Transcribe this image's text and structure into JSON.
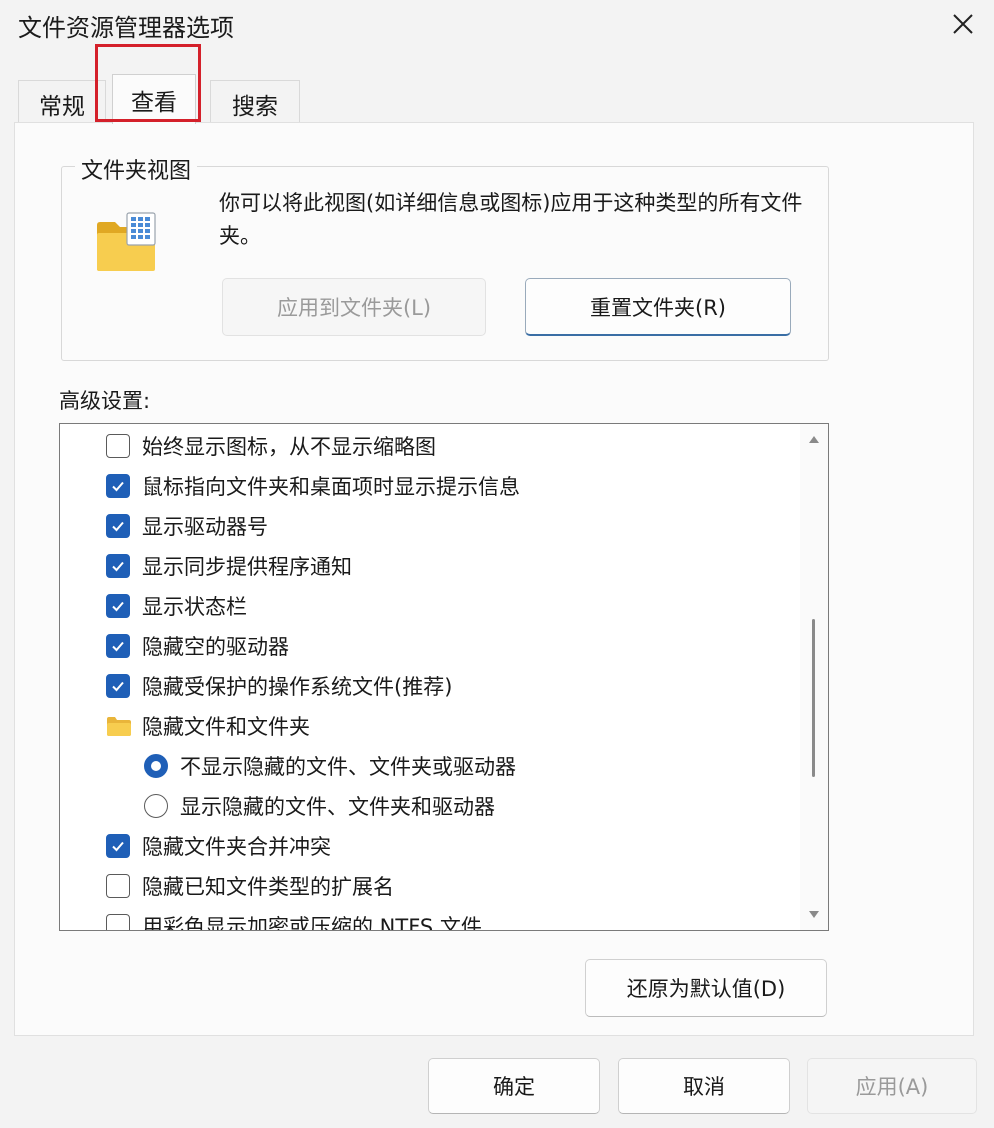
{
  "window": {
    "title": "文件资源管理器选项"
  },
  "tabs": [
    {
      "label": "常规"
    },
    {
      "label": "查看",
      "selected": true
    },
    {
      "label": "搜索"
    }
  ],
  "folder_views": {
    "title": "文件夹视图",
    "description": "你可以将此视图(如详细信息或图标)应用于这种类型的所有文件夹。",
    "apply_button": "应用到文件夹(L)",
    "reset_button": "重置文件夹(R)"
  },
  "advanced": {
    "label": "高级设置:",
    "items": [
      {
        "kind": "checkbox",
        "label": "始终显示图标，从不显示缩略图",
        "checked": false
      },
      {
        "kind": "checkbox",
        "label": "鼠标指向文件夹和桌面项时显示提示信息",
        "checked": true
      },
      {
        "kind": "checkbox",
        "label": "显示驱动器号",
        "checked": true
      },
      {
        "kind": "checkbox",
        "label": "显示同步提供程序通知",
        "checked": true
      },
      {
        "kind": "checkbox",
        "label": "显示状态栏",
        "checked": true
      },
      {
        "kind": "checkbox",
        "label": "隐藏空的驱动器",
        "checked": true
      },
      {
        "kind": "checkbox",
        "label": "隐藏受保护的操作系统文件(推荐)",
        "checked": true
      },
      {
        "kind": "folder",
        "label": "隐藏文件和文件夹"
      },
      {
        "kind": "radio",
        "label": "不显示隐藏的文件、文件夹或驱动器",
        "checked": true
      },
      {
        "kind": "radio",
        "label": "显示隐藏的文件、文件夹和驱动器",
        "checked": false
      },
      {
        "kind": "checkbox",
        "label": "隐藏文件夹合并冲突",
        "checked": true
      },
      {
        "kind": "checkbox",
        "label": "隐藏已知文件类型的扩展名",
        "checked": false
      },
      {
        "kind": "checkbox",
        "label": "用彩色显示加密或压缩的 NTFS 文件",
        "checked": false
      }
    ],
    "restore_button": "还原为默认值(D)"
  },
  "footer": {
    "ok": "确定",
    "cancel": "取消",
    "apply": "应用(A)"
  },
  "colors": {
    "accent": "#1f5fb7",
    "highlight_box": "#d4202a",
    "folder_yellow": "#f5c842"
  }
}
